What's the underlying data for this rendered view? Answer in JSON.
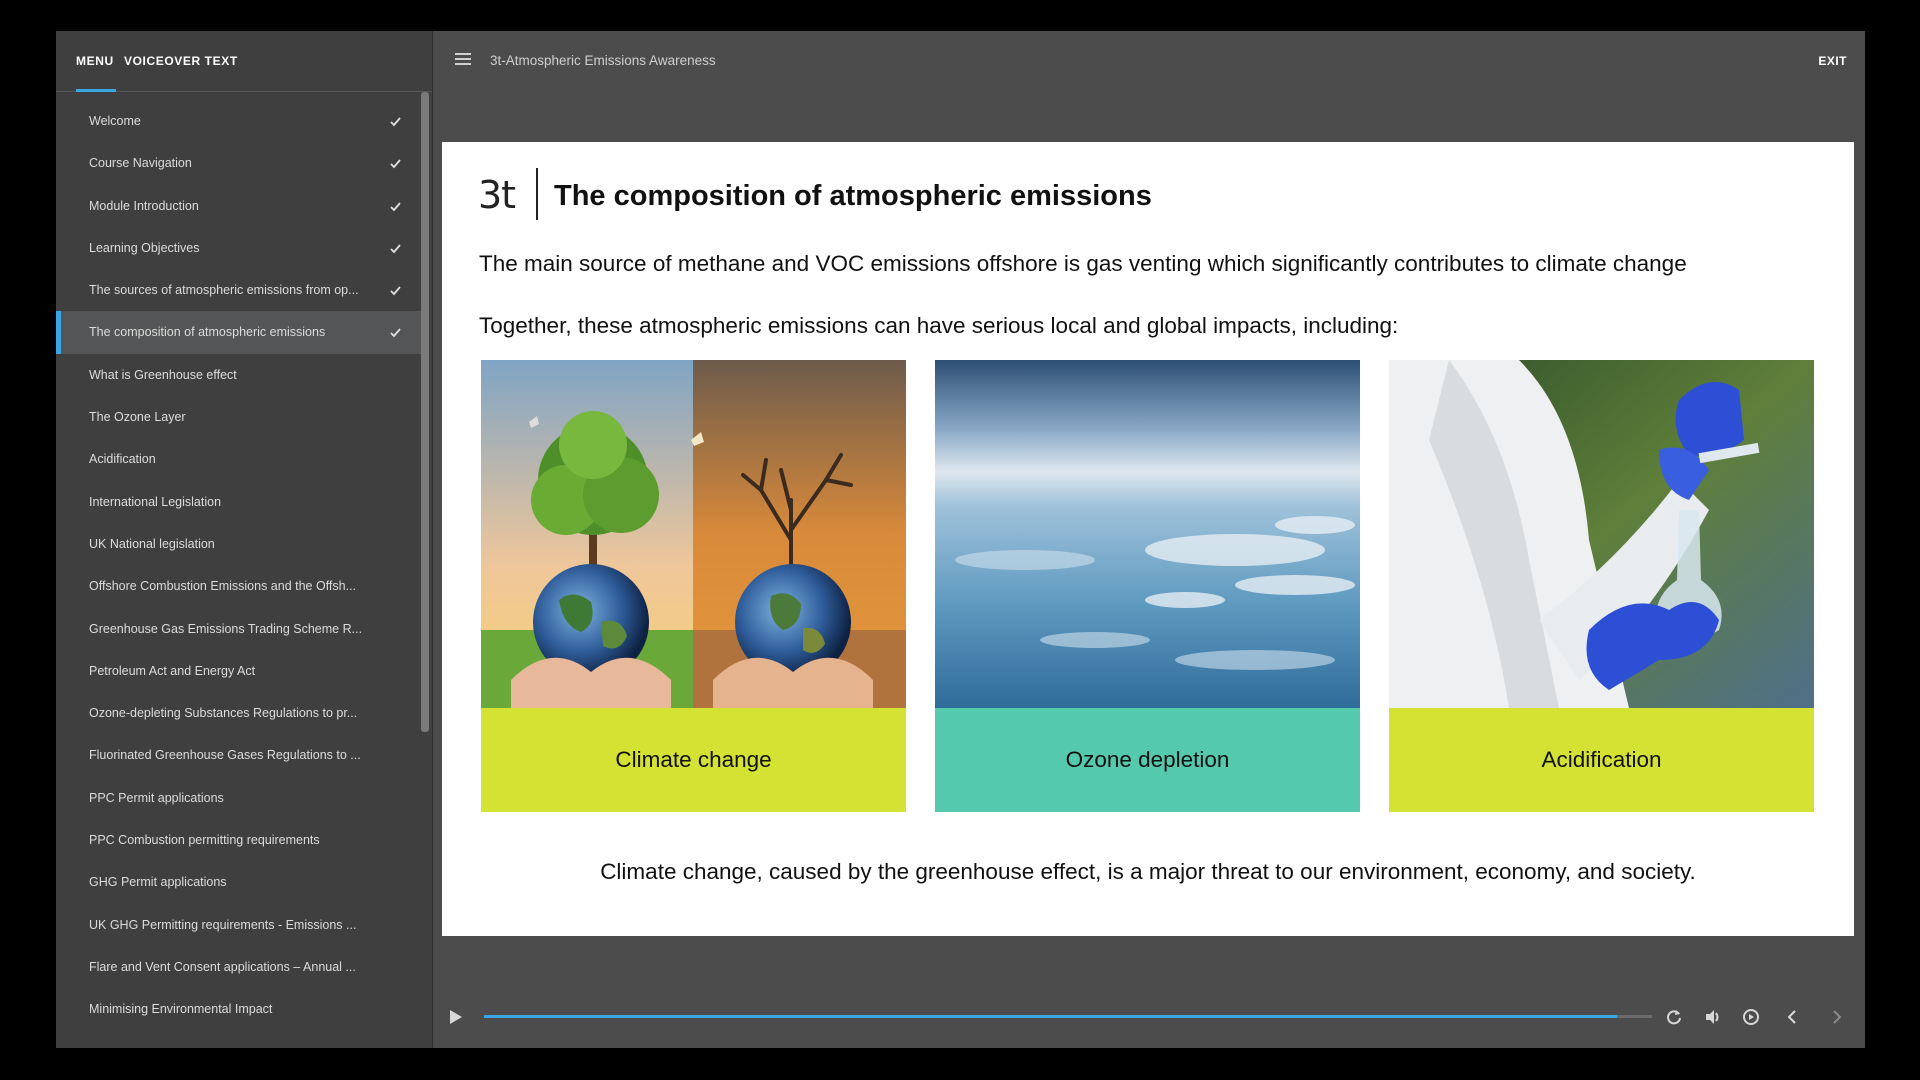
{
  "sidebar": {
    "tabs": {
      "menu": "MENU",
      "voiceover": "VOICEOVER TEXT"
    },
    "items": [
      {
        "label": "Welcome",
        "done": true
      },
      {
        "label": "Course Navigation",
        "done": true
      },
      {
        "label": "Module Introduction",
        "done": true
      },
      {
        "label": "Learning Objectives",
        "done": true
      },
      {
        "label": "The sources of atmospheric emissions from op...",
        "done": true
      },
      {
        "label": "The composition of atmospheric emissions",
        "done": true,
        "active": true
      },
      {
        "label": "What is Greenhouse effect",
        "done": false
      },
      {
        "label": "The Ozone Layer",
        "done": false
      },
      {
        "label": "Acidification",
        "done": false
      },
      {
        "label": "International Legislation",
        "done": false
      },
      {
        "label": "UK National legislation",
        "done": false
      },
      {
        "label": "Offshore Combustion Emissions and the Offsh...",
        "done": false
      },
      {
        "label": "Greenhouse Gas Emissions Trading Scheme R...",
        "done": false
      },
      {
        "label": "Petroleum Act and Energy Act",
        "done": false
      },
      {
        "label": "Ozone-depleting Substances Regulations to pr...",
        "done": false
      },
      {
        "label": "Fluorinated Greenhouse Gases Regulations to ...",
        "done": false
      },
      {
        "label": "PPC Permit applications",
        "done": false
      },
      {
        "label": "PPC Combustion permitting requirements",
        "done": false
      },
      {
        "label": "GHG Permit applications",
        "done": false
      },
      {
        "label": "UK GHG Permitting requirements - Emissions ...",
        "done": false
      },
      {
        "label": "Flare and Vent Consent applications – Annual ...",
        "done": false
      },
      {
        "label": "Minimising Environmental Impact",
        "done": false
      }
    ]
  },
  "topbar": {
    "course_title": "3t-Atmospheric Emissions Awareness",
    "exit": "EXIT"
  },
  "slide": {
    "logo": "3t",
    "title": "The composition of atmospheric emissions",
    "paragraph1": "The main source of methane and VOC emissions offshore is gas venting which significantly contributes to climate change",
    "paragraph2": "Together, these atmospheric emissions can have serious local and global impacts, including:",
    "cards": [
      {
        "caption": "Climate change",
        "color": "#d4e233"
      },
      {
        "caption": "Ozone depletion",
        "color": "#55c9ad"
      },
      {
        "caption": "Acidification",
        "color": "#d4e233"
      }
    ],
    "paragraph3": "Climate change, caused by the greenhouse effect, is a major threat to our environment, economy, and society."
  },
  "player": {
    "progress": 0.97,
    "accent": "#3aa7e3"
  },
  "icons": {
    "hamburger": "hamburger-icon",
    "check": "check-icon",
    "play": "play-icon",
    "replay": "replay-icon",
    "volume": "volume-icon",
    "captions": "captions-icon",
    "prev": "chevron-left-icon",
    "next": "chevron-right-icon"
  }
}
